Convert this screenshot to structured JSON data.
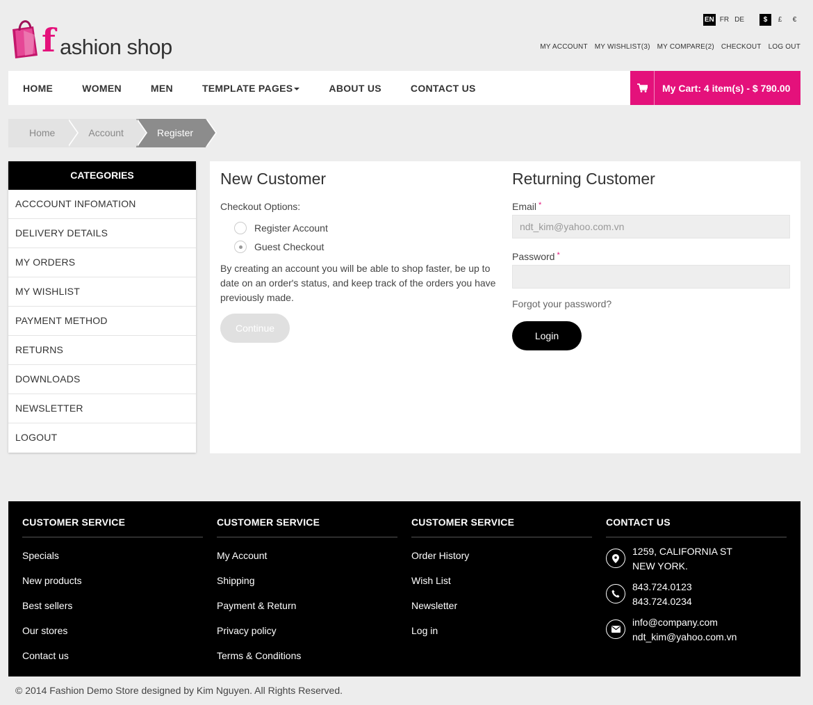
{
  "logo": {
    "letter": "f",
    "text": "ashion shop"
  },
  "languages": [
    "EN",
    "FR",
    "DE"
  ],
  "currencies": [
    "$",
    "£",
    "€"
  ],
  "top_links": [
    "MY ACCOUNT",
    "MY WISHLIST(3)",
    "MY COMPARE(2)",
    "CHECKOUT",
    "LOG OUT"
  ],
  "nav": {
    "items": [
      "HOME",
      "WOMEN",
      "MEN",
      "TEMPLATE PAGES",
      "ABOUT US",
      "CONTACT US"
    ],
    "cart_label": "My Cart: 4 item(s) - $ 790.00"
  },
  "breadcrumb": [
    "Home",
    "Account",
    "Register"
  ],
  "sidebar": {
    "title": "CATEGORIES",
    "items": [
      "ACCCOUNT INFOMATION",
      "DELIVERY DETAILS",
      "MY ORDERS",
      "MY WISHLIST",
      "PAYMENT METHOD",
      "RETURNS",
      "DOWNLOADS",
      "NEWSLETTER",
      "LOGOUT"
    ]
  },
  "new_customer": {
    "title": "New Customer",
    "options_label": "Checkout Options:",
    "options": [
      "Register Account",
      "Guest Checkout"
    ],
    "description": "By creating an account you will be able to shop faster, be up to date on an order's status, and keep track of the orders you have previously made.",
    "button": "Continue"
  },
  "returning_customer": {
    "title": "Returning Customer",
    "email_label": "Email",
    "email_value": "ndt_kim@yahoo.com.vn",
    "password_label": "Password",
    "required_mark": "*",
    "forgot": "Forgot your password?",
    "button": "Login"
  },
  "footer": {
    "col1": {
      "title": "CUSTOMER SERVICE",
      "links": [
        "Specials",
        "New products",
        "Best sellers",
        "Our stores",
        "Contact us"
      ]
    },
    "col2": {
      "title": "CUSTOMER SERVICE",
      "links": [
        "My Account",
        "Shipping",
        "Payment & Return",
        "Privacy policy",
        "Terms & Conditions"
      ]
    },
    "col3": {
      "title": "CUSTOMER SERVICE",
      "links": [
        "Order History",
        "Wish List",
        "Newsletter",
        "Log in"
      ]
    },
    "contact": {
      "title": "CONTACT US",
      "address": [
        "1259, CALIFORNIA ST",
        "NEW YORK."
      ],
      "phones": [
        "843.724.0123",
        "843.724.0234"
      ],
      "emails": [
        "info@company.com",
        "ndt_kim@yahoo.com.vn"
      ]
    },
    "copyright": "© 2014 Fashion Demo Store designed by Kim Nguyen. All Rights Reserved."
  },
  "colors": {
    "brand_pink": "#e4117b",
    "dark": "#000000"
  }
}
